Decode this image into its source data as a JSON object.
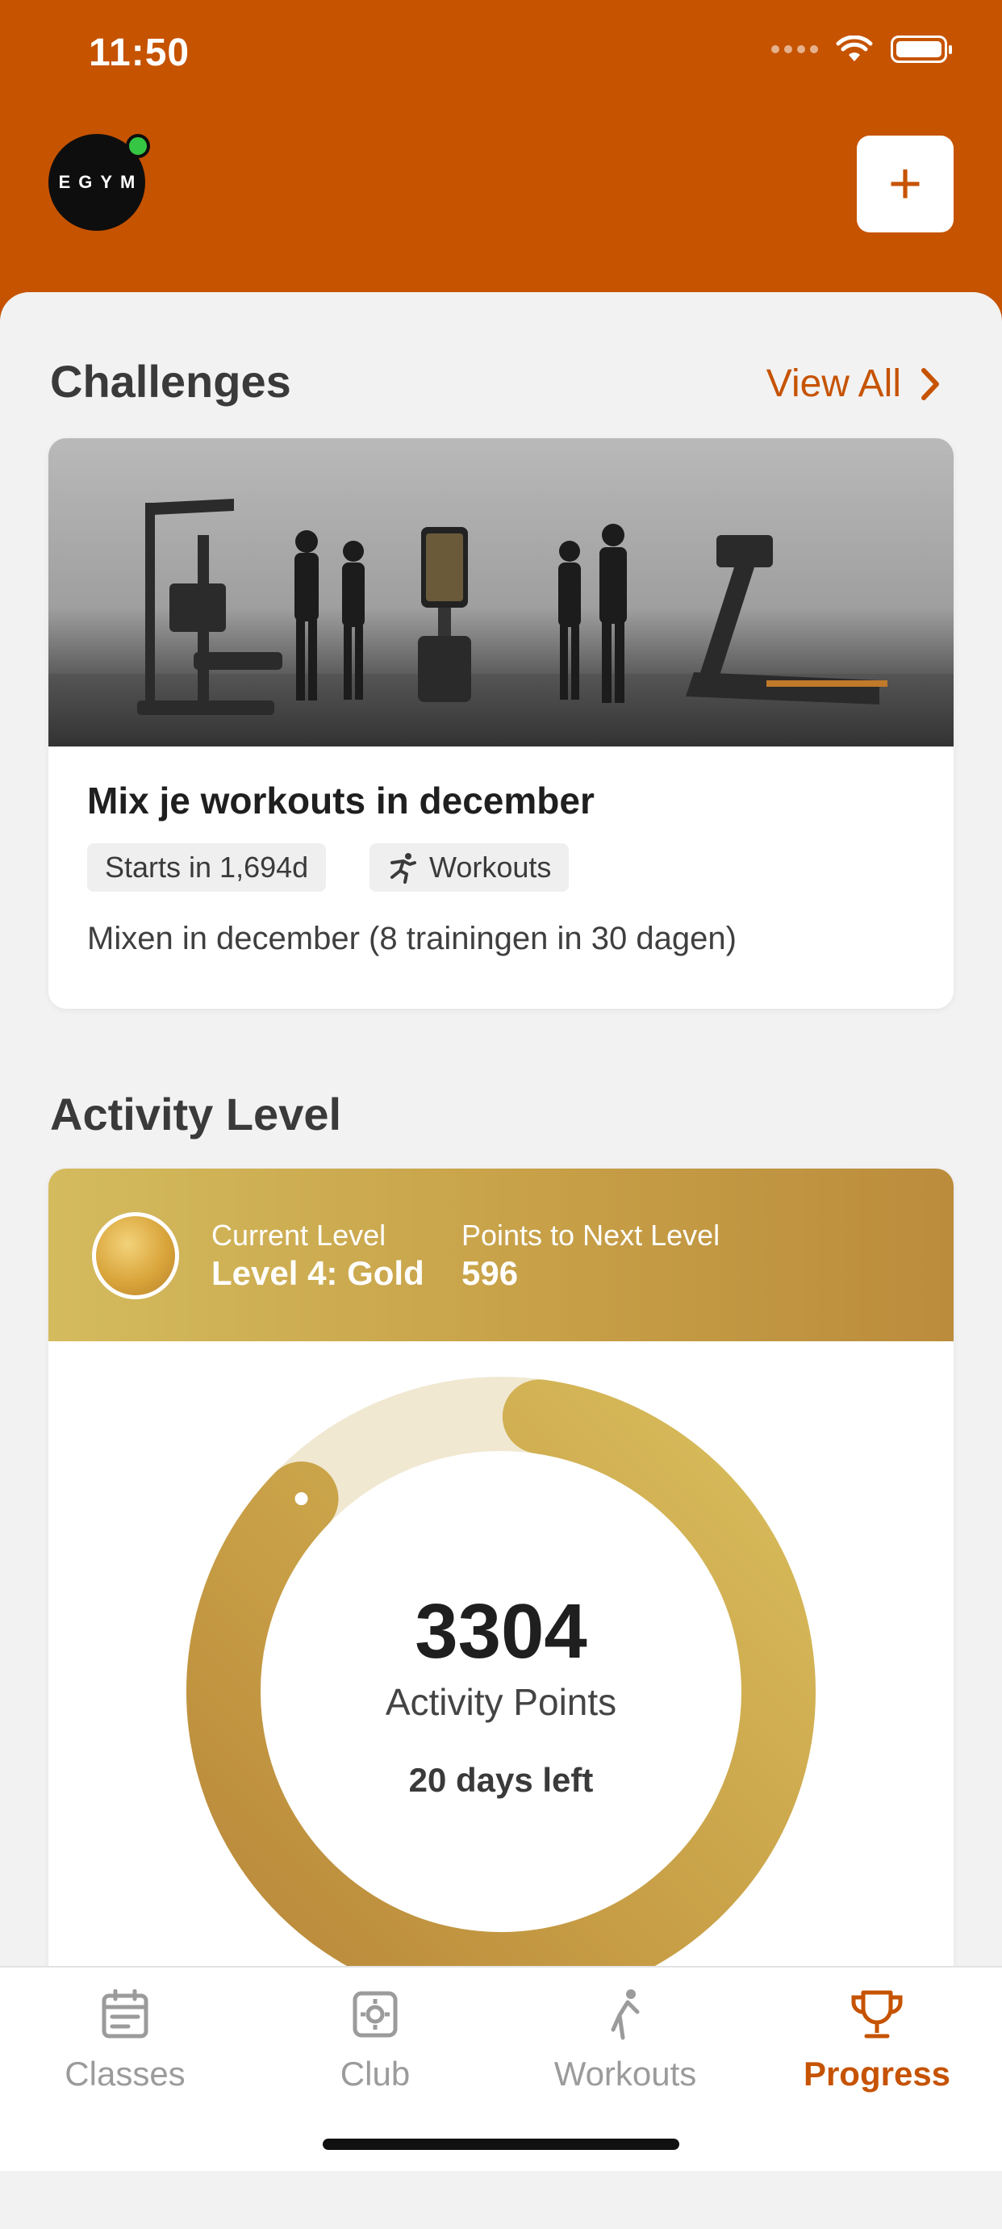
{
  "status_bar": {
    "time": "11:50"
  },
  "header": {
    "logo_text": "EGYM",
    "add_label": "+"
  },
  "challenges": {
    "title": "Challenges",
    "view_all": "View All",
    "card": {
      "title": "Mix je workouts in december",
      "tag_start": "Starts in 1,694d",
      "tag_type": "Workouts",
      "description": "Mixen in december (8 trainingen in 30 dagen)"
    }
  },
  "activity": {
    "title": "Activity Level",
    "current_level_label": "Current Level",
    "current_level_value": "Level 4: Gold",
    "next_level_label": "Points to Next Level",
    "next_level_value": "596",
    "points": "3304",
    "points_label": "Activity Points",
    "days_left": "20 days left",
    "progress_fraction": 0.85
  },
  "tabs": [
    {
      "label": "Classes",
      "icon": "calendar-icon"
    },
    {
      "label": "Club",
      "icon": "club-icon"
    },
    {
      "label": "Workouts",
      "icon": "workout-figure-icon"
    },
    {
      "label": "Progress",
      "icon": "trophy-icon"
    }
  ],
  "colors": {
    "brand": "#c65300",
    "gold": "#c9a24a",
    "gold_light": "#f1e8d2"
  }
}
